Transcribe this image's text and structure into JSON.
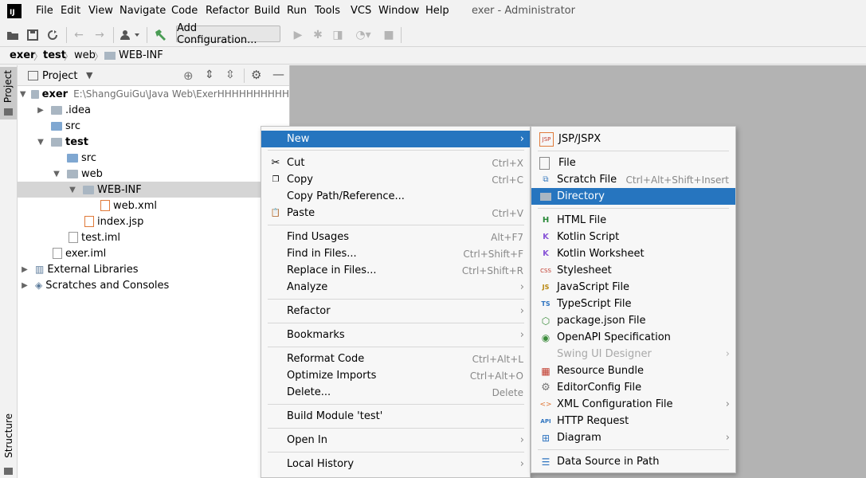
{
  "app": {
    "logo_text": "IJ",
    "window_title": "exer - Administrator"
  },
  "menubar": [
    "File",
    "Edit",
    "View",
    "Navigate",
    "Code",
    "Refactor",
    "Build",
    "Run",
    "Tools",
    "VCS",
    "Window",
    "Help"
  ],
  "toolbar": {
    "add_configuration": "Add Configuration..."
  },
  "breadcrumb": [
    "exer",
    "test",
    "web",
    "WEB-INF"
  ],
  "left_strip": {
    "project": "Project",
    "structure": "Structure"
  },
  "project_panel": {
    "title": "Project"
  },
  "tree": [
    {
      "name": "exer",
      "path": "E:\\ShangGuiGu\\Java Web\\ExerHHHHHHHHHH"
    },
    {
      "name": ".idea"
    },
    {
      "name": "src"
    },
    {
      "name": "test"
    },
    {
      "name": "src"
    },
    {
      "name": "web"
    },
    {
      "name": "WEB-INF"
    },
    {
      "name": "web.xml"
    },
    {
      "name": "index.jsp"
    },
    {
      "name": "test.iml"
    },
    {
      "name": "exer.iml"
    },
    {
      "name": "External Libraries"
    },
    {
      "name": "Scratches and Consoles"
    }
  ],
  "context_menu": [
    {
      "label": "New"
    },
    {
      "label": "Cut",
      "shortcut": "Ctrl+X"
    },
    {
      "label": "Copy",
      "shortcut": "Ctrl+C"
    },
    {
      "label": "Copy Path/Reference..."
    },
    {
      "label": "Paste",
      "shortcut": "Ctrl+V"
    },
    {
      "label": "Find Usages",
      "shortcut": "Alt+F7"
    },
    {
      "label": "Find in Files...",
      "shortcut": "Ctrl+Shift+F"
    },
    {
      "label": "Replace in Files...",
      "shortcut": "Ctrl+Shift+R"
    },
    {
      "label": "Analyze"
    },
    {
      "label": "Refactor"
    },
    {
      "label": "Bookmarks"
    },
    {
      "label": "Reformat Code",
      "shortcut": "Ctrl+Alt+L"
    },
    {
      "label": "Optimize Imports",
      "shortcut": "Ctrl+Alt+O"
    },
    {
      "label": "Delete...",
      "shortcut": "Delete"
    },
    {
      "label": "Build Module 'test'"
    },
    {
      "label": "Open In"
    },
    {
      "label": "Local History"
    }
  ],
  "new_submenu": [
    {
      "label": "JSP/JSPX",
      "icon": "JSP"
    },
    {
      "label": "File"
    },
    {
      "label": "Scratch File",
      "shortcut": "Ctrl+Alt+Shift+Insert"
    },
    {
      "label": "Directory"
    },
    {
      "label": "HTML File",
      "icon": "H"
    },
    {
      "label": "Kotlin Script",
      "icon": "K"
    },
    {
      "label": "Kotlin Worksheet",
      "icon": "K"
    },
    {
      "label": "Stylesheet",
      "icon": "CSS"
    },
    {
      "label": "JavaScript File",
      "icon": "JS"
    },
    {
      "label": "TypeScript File",
      "icon": "TS"
    },
    {
      "label": "package.json File"
    },
    {
      "label": "OpenAPI Specification"
    },
    {
      "label": "Swing UI Designer"
    },
    {
      "label": "Resource Bundle"
    },
    {
      "label": "EditorConfig File"
    },
    {
      "label": "XML Configuration File"
    },
    {
      "label": "HTTP Request",
      "icon": "API"
    },
    {
      "label": "Diagram"
    },
    {
      "label": "Data Source in Path"
    }
  ]
}
